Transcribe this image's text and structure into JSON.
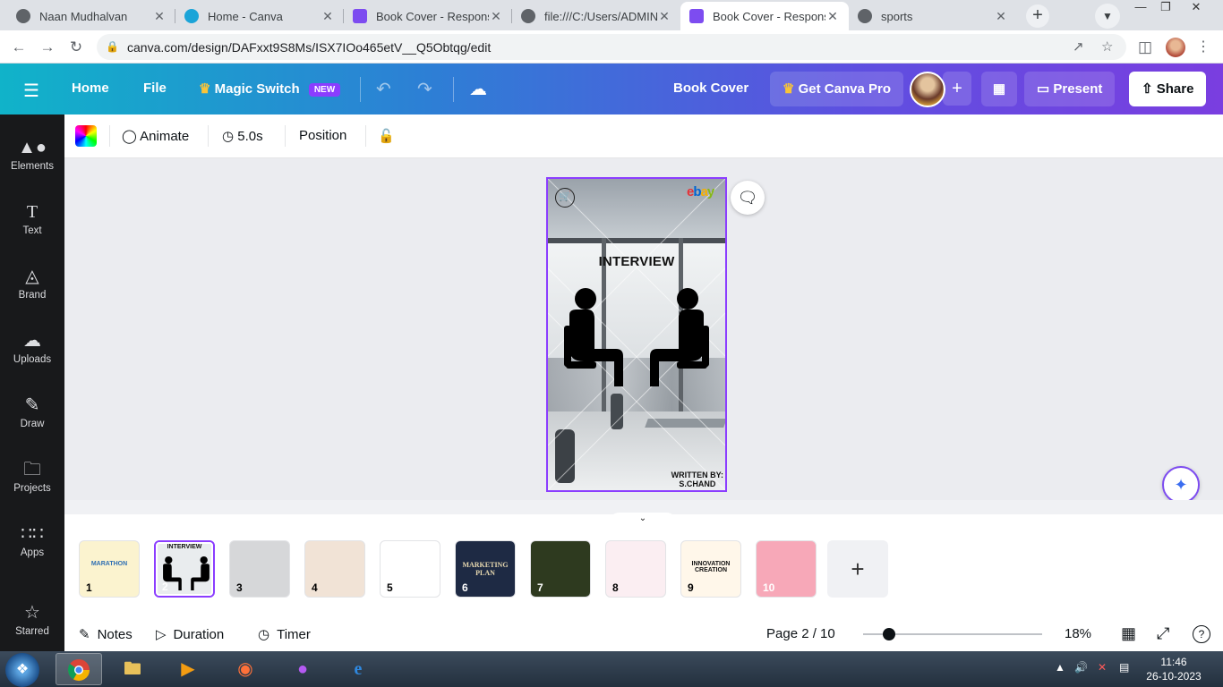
{
  "browser": {
    "tabs": [
      {
        "title": "Naan Mudhalvan",
        "icon": "globe-icon",
        "active": false
      },
      {
        "title": "Home - Canva",
        "icon": "canva-icon",
        "active": false
      },
      {
        "title": "Book Cover - Responsive",
        "icon": "canva-doc-icon",
        "active": false
      },
      {
        "title": "file:///C:/Users/ADMIN/",
        "icon": "globe-icon",
        "active": false
      },
      {
        "title": "Book Cover - Responsive",
        "icon": "canva-doc-icon",
        "active": true
      },
      {
        "title": "sports",
        "icon": "globe-icon",
        "active": false
      }
    ],
    "close_glyph": "✕",
    "new_tab_glyph": "+",
    "url": "canva.com/design/DAFxxt9S8Ms/ISX7IOo465etV__Q5Obtqg/edit"
  },
  "header": {
    "home": "Home",
    "file": "File",
    "magic_switch": "Magic Switch",
    "new_badge": "NEW",
    "doc_title": "Book Cover",
    "get_pro": "Get Canva Pro",
    "present": "Present",
    "share": "Share"
  },
  "sidebar": {
    "items": [
      {
        "label": "Elements",
        "icon": "elements-icon"
      },
      {
        "label": "Text",
        "icon": "text-icon"
      },
      {
        "label": "Brand",
        "icon": "brand-icon"
      },
      {
        "label": "Uploads",
        "icon": "upload-icon"
      },
      {
        "label": "Draw",
        "icon": "draw-icon"
      },
      {
        "label": "Projects",
        "icon": "folder-icon"
      },
      {
        "label": "Apps",
        "icon": "apps-icon"
      },
      {
        "label": "Starred",
        "icon": "star-icon"
      }
    ]
  },
  "toolbar": {
    "animate": "Animate",
    "duration": "5.0s",
    "position": "Position"
  },
  "design": {
    "title": "INTERVIEW",
    "brand": "ebay",
    "author_line1": "WRITTEN BY:",
    "author_line2": "S.CHAND"
  },
  "pages": {
    "thumbnails": [
      {
        "num": "1",
        "text": "MARATHON",
        "bg": "#fbf3cf",
        "fg": "#2f6fb3"
      },
      {
        "num": "2",
        "text": "INTERVIEW",
        "bg": "#e9ecee",
        "fg": "#111111",
        "selected": true
      },
      {
        "num": "3",
        "text": "",
        "bg": "#d6d7d9",
        "fg": "#333333"
      },
      {
        "num": "4",
        "text": "",
        "bg": "#f1e3d6",
        "fg": "#a67c61"
      },
      {
        "num": "5",
        "text": "",
        "bg": "#ffffff",
        "fg": "#c05050"
      },
      {
        "num": "6",
        "text": "MARKETING PLAN",
        "bg": "#1e2a44",
        "fg": "#e8d9b0"
      },
      {
        "num": "7",
        "text": "",
        "bg": "#2e3a1f",
        "fg": "#ffffff"
      },
      {
        "num": "8",
        "text": "",
        "bg": "#fbeef2",
        "fg": "#c54a7a"
      },
      {
        "num": "9",
        "text": "INNOVATION CREATION",
        "bg": "#fff7ea",
        "fg": "#111111"
      },
      {
        "num": "10",
        "text": "",
        "bg": "#f7a8b8",
        "fg": "#ffffff"
      }
    ],
    "add_glyph": "+"
  },
  "footer": {
    "notes": "Notes",
    "duration": "Duration",
    "timer": "Timer",
    "page_indicator": "Page 2 / 10",
    "zoom": "18%",
    "zoom_level": 0.18
  },
  "taskbar": {
    "time": "11:46",
    "date": "26-10-2023"
  },
  "colors": {
    "accent": "#8b3dff",
    "sidebar_bg": "#18191b"
  }
}
